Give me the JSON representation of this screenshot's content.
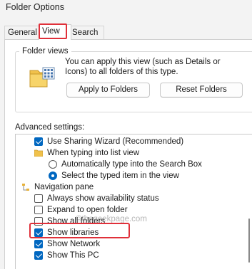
{
  "window": {
    "title": "Folder Options"
  },
  "tabs": [
    {
      "label": "General",
      "selected": false
    },
    {
      "label": "View",
      "selected": true
    },
    {
      "label": "Search",
      "selected": false
    }
  ],
  "folder_views": {
    "legend": "Folder views",
    "description": "You can apply this view (such as Details or Icons) to all folders of this type.",
    "apply_button": "Apply to Folders",
    "reset_button": "Reset Folders"
  },
  "advanced": {
    "label": "Advanced settings:",
    "items": [
      {
        "label": "Use Sharing Wizard (Recommended)",
        "control": "checkbox",
        "checked": true
      },
      {
        "label": "When typing into list view",
        "control": "folder",
        "checked": false
      },
      {
        "label": "Automatically type into the Search Box",
        "control": "radio",
        "checked": false
      },
      {
        "label": "Select the typed item in the view",
        "control": "radio",
        "checked": true
      },
      {
        "label": "Navigation pane",
        "control": "nav",
        "checked": false
      },
      {
        "label": "Always show availability status",
        "control": "checkbox",
        "checked": false
      },
      {
        "label": "Expand to open folder",
        "control": "checkbox",
        "checked": false
      },
      {
        "label": "Show all folders",
        "control": "checkbox",
        "checked": false
      },
      {
        "label": "Show libraries",
        "control": "checkbox",
        "checked": true
      },
      {
        "label": "Show Network",
        "control": "checkbox",
        "checked": true
      },
      {
        "label": "Show This PC",
        "control": "checkbox",
        "checked": true
      }
    ]
  },
  "watermark": "©thegeekpage.com",
  "colors": {
    "accent": "#0067c0",
    "highlight": "#e0303a"
  }
}
